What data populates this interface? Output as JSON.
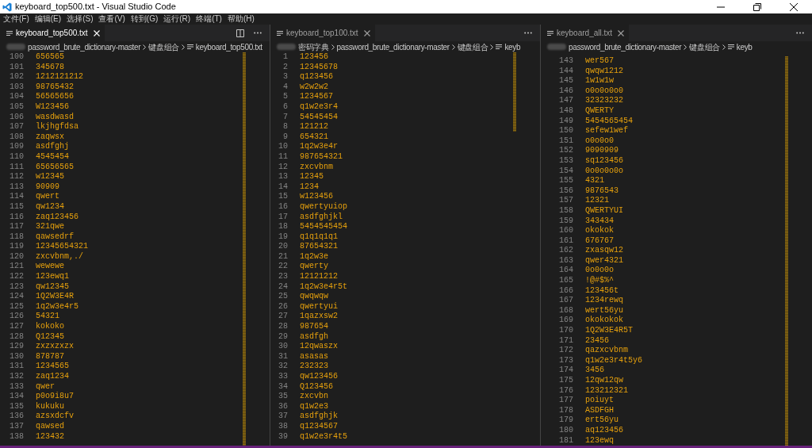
{
  "window": {
    "title": "keyboard_top500.txt - Visual Studio Code"
  },
  "menu": [
    "文件(F)",
    "编辑(E)",
    "选择(S)",
    "查看(V)",
    "转到(G)",
    "运行(R)",
    "终端(T)",
    "帮助(H)"
  ],
  "panes": [
    {
      "tab": {
        "label": "keyboard_top500.txt",
        "selected": true
      },
      "split_button": true,
      "breadcrumbs": [
        {
          "text": "password_brute_dictionary-master",
          "kind": "folder"
        },
        {
          "text": "键盘组合",
          "kind": "folder"
        },
        {
          "text": "keyboard_top500.txt",
          "kind": "file"
        }
      ],
      "lines": [
        {
          "n": "100",
          "text": "656565"
        },
        {
          "n": "101",
          "text": "345678"
        },
        {
          "n": "102",
          "text": "1212121212"
        },
        {
          "n": "103",
          "text": "98765432"
        },
        {
          "n": "104",
          "text": "56565656"
        },
        {
          "n": "105",
          "text": "W123456"
        },
        {
          "n": "106",
          "text": "wasdwasd"
        },
        {
          "n": "107",
          "text": "lkjhgfdsa"
        },
        {
          "n": "108",
          "text": "zaqwsx"
        },
        {
          "n": "109",
          "text": "asdfghj"
        },
        {
          "n": "110",
          "text": "4545454"
        },
        {
          "n": "111",
          "text": "65656565"
        },
        {
          "n": "112",
          "text": "w12345"
        },
        {
          "n": "113",
          "text": "90909"
        },
        {
          "n": "114",
          "text": "qwert"
        },
        {
          "n": "115",
          "text": "qw1234"
        },
        {
          "n": "116",
          "text": "zaq123456"
        },
        {
          "n": "117",
          "text": "321qwe"
        },
        {
          "n": "118",
          "text": "qawsedrf"
        },
        {
          "n": "119",
          "text": "12345654321"
        },
        {
          "n": "120",
          "text": "zxcvbnm,./"
        },
        {
          "n": "121",
          "text": "wewewe"
        },
        {
          "n": "122",
          "text": "123ewq1"
        },
        {
          "n": "123",
          "text": "qw12345"
        },
        {
          "n": "124",
          "text": "1Q2W3E4R"
        },
        {
          "n": "125",
          "text": "1q2w3e4r5"
        },
        {
          "n": "126",
          "text": "54321"
        },
        {
          "n": "127",
          "text": "kokoko"
        },
        {
          "n": "128",
          "text": "Q12345"
        },
        {
          "n": "129",
          "text": "zxzxzxzx"
        },
        {
          "n": "130",
          "text": "878787"
        },
        {
          "n": "131",
          "text": "1234565"
        },
        {
          "n": "132",
          "text": "zaq1234"
        },
        {
          "n": "133",
          "text": "qwer"
        },
        {
          "n": "134",
          "text": "p0o9i8u7"
        },
        {
          "n": "135",
          "text": "kukuku"
        },
        {
          "n": "136",
          "text": "azsxdcfv"
        },
        {
          "n": "137",
          "text": "qawsed"
        },
        {
          "n": "138",
          "text": "123432"
        }
      ]
    },
    {
      "tab": {
        "label": "keyboard_top100.txt",
        "selected": false
      },
      "breadcrumbs": [
        {
          "text": "密码字典",
          "kind": "folder"
        },
        {
          "text": "password_brute_dictionary-master",
          "kind": "folder"
        },
        {
          "text": "键盘组合",
          "kind": "folder"
        },
        {
          "text": "keyb",
          "kind": "file"
        }
      ],
      "lines": [
        {
          "n": "1",
          "text": "123456"
        },
        {
          "n": "2",
          "text": "12345678"
        },
        {
          "n": "3",
          "text": "q123456"
        },
        {
          "n": "4",
          "text": "w2w2w2"
        },
        {
          "n": "5",
          "text": "1234567"
        },
        {
          "n": "6",
          "text": "q1w2e3r4"
        },
        {
          "n": "7",
          "text": "54545454"
        },
        {
          "n": "8",
          "text": "121212"
        },
        {
          "n": "9",
          "text": "654321"
        },
        {
          "n": "10",
          "text": "1q2w3e4r"
        },
        {
          "n": "11",
          "text": "987654321"
        },
        {
          "n": "12",
          "text": "zxcvbnm"
        },
        {
          "n": "13",
          "text": "12345"
        },
        {
          "n": "14",
          "text": "1234"
        },
        {
          "n": "15",
          "text": "w123456"
        },
        {
          "n": "16",
          "text": "qwertyuiop"
        },
        {
          "n": "17",
          "text": "asdfghjkl"
        },
        {
          "n": "18",
          "text": "5454545454"
        },
        {
          "n": "19",
          "text": "q1q1q1q1"
        },
        {
          "n": "20",
          "text": "87654321"
        },
        {
          "n": "21",
          "text": "1q2w3e"
        },
        {
          "n": "22",
          "text": "qwerty"
        },
        {
          "n": "23",
          "text": "12121212"
        },
        {
          "n": "24",
          "text": "1q2w3e4r5t"
        },
        {
          "n": "25",
          "text": "qwqwqw"
        },
        {
          "n": "26",
          "text": "qwertyui"
        },
        {
          "n": "27",
          "text": "1qazxsw2"
        },
        {
          "n": "28",
          "text": "987654"
        },
        {
          "n": "29",
          "text": "asdfgh"
        },
        {
          "n": "30",
          "text": "12qwaszx"
        },
        {
          "n": "31",
          "text": "asasas"
        },
        {
          "n": "32",
          "text": "232323"
        },
        {
          "n": "33",
          "text": "qw123456"
        },
        {
          "n": "34",
          "text": "Q123456"
        },
        {
          "n": "35",
          "text": "zxcvbn"
        },
        {
          "n": "36",
          "text": "q1w2e3"
        },
        {
          "n": "37",
          "text": "asdfghjk"
        },
        {
          "n": "38",
          "text": "q1234567"
        },
        {
          "n": "39",
          "text": "q1w2e3r4t5"
        }
      ]
    },
    {
      "tab": {
        "label": "keyboard_all.txt",
        "selected": false
      },
      "breadcrumbs": [
        {
          "text": "password_brute_dictionary-master",
          "kind": "folder"
        },
        {
          "text": "键盘组合",
          "kind": "folder"
        },
        {
          "text": "keyb",
          "kind": "file"
        }
      ],
      "lines": [
        {
          "n": "143",
          "text": "wer567"
        },
        {
          "n": "144",
          "text": "qwqw1212"
        },
        {
          "n": "145",
          "text": "1w1w1w"
        },
        {
          "n": "146",
          "text": "o0o0o0o0"
        },
        {
          "n": "147",
          "text": "32323232"
        },
        {
          "n": "148",
          "text": "QWERTY"
        },
        {
          "n": "149",
          "text": "5454565454"
        },
        {
          "n": "150",
          "text": "sefew1wef"
        },
        {
          "n": "151",
          "text": "o0o0o0"
        },
        {
          "n": "152",
          "text": "9090909"
        },
        {
          "n": "153",
          "text": "sq123456"
        },
        {
          "n": "154",
          "text": "0o0o0o0o"
        },
        {
          "n": "155",
          "text": "4321"
        },
        {
          "n": "156",
          "text": "9876543"
        },
        {
          "n": "157",
          "text": "12321"
        },
        {
          "n": "158",
          "text": "QWERTYUI"
        },
        {
          "n": "159",
          "text": "343434"
        },
        {
          "n": "160",
          "text": "okokok"
        },
        {
          "n": "161",
          "text": "676767"
        },
        {
          "n": "162",
          "text": "zxasqw12"
        },
        {
          "n": "163",
          "text": "qwer4321"
        },
        {
          "n": "164",
          "text": "0o0o0o"
        },
        {
          "n": "165",
          "text": "!@#$%^"
        },
        {
          "n": "166",
          "text": "123456t"
        },
        {
          "n": "167",
          "text": "1234rewq"
        },
        {
          "n": "168",
          "text": "wert56yu"
        },
        {
          "n": "169",
          "text": "okokokok"
        },
        {
          "n": "170",
          "text": "1Q2W3E4R5T"
        },
        {
          "n": "171",
          "text": "23456"
        },
        {
          "n": "172",
          "text": "qazxcvbnm"
        },
        {
          "n": "173",
          "text": "q1w2e3r4t5y6"
        },
        {
          "n": "174",
          "text": "3456"
        },
        {
          "n": "175",
          "text": "12qw12qw"
        },
        {
          "n": "176",
          "text": "123212321"
        },
        {
          "n": "177",
          "text": "poiuyt"
        },
        {
          "n": "178",
          "text": "ASDFGH"
        },
        {
          "n": "179",
          "text": "ert56yu"
        },
        {
          "n": "180",
          "text": "aq123456"
        },
        {
          "n": "181",
          "text": "123ewq"
        }
      ]
    }
  ]
}
